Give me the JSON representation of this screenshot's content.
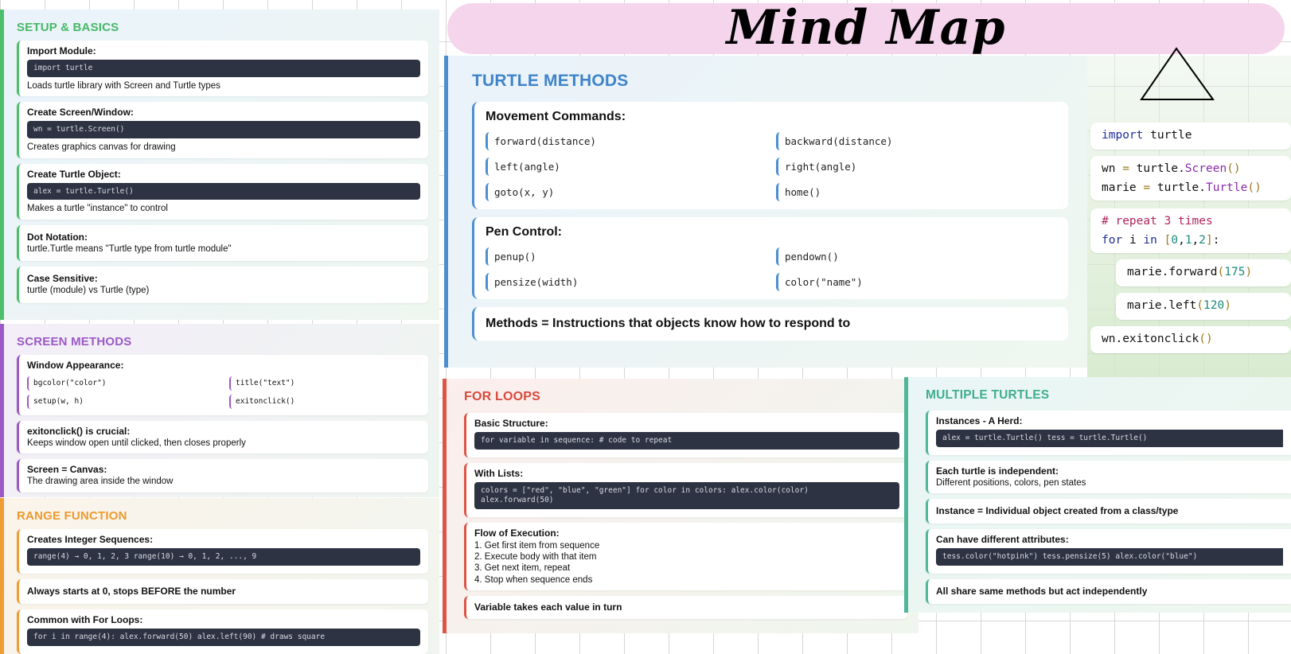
{
  "title": "Mind Map",
  "setup": {
    "title": "SETUP & BASICS",
    "cards": [
      {
        "heading": "Import Module:",
        "code": "import turtle",
        "text": "Loads turtle library with Screen and Turtle types"
      },
      {
        "heading": "Create Screen/Window:",
        "code": "wn = turtle.Screen()",
        "text": "Creates graphics canvas for drawing"
      },
      {
        "heading": "Create Turtle Object:",
        "code": "alex = turtle.Turtle()",
        "text": "Makes a turtle \"instance\" to control"
      },
      {
        "heading": "Dot Notation:",
        "text": "turtle.Turtle means \"Turtle type from turtle module\""
      },
      {
        "heading": "Case Sensitive:",
        "text": "turtle (module) vs Turtle (type)"
      }
    ]
  },
  "screen": {
    "title": "SCREEN METHODS",
    "appearance_heading": "Window Appearance:",
    "methods": [
      "bgcolor(\"color\")",
      "title(\"text\")",
      "setup(w, h)",
      "exitonclick()"
    ],
    "cards": [
      {
        "heading": "exitonclick() is crucial:",
        "text": "Keeps window open until clicked, then closes properly"
      },
      {
        "heading": "Screen = Canvas:",
        "text": "The drawing area inside the window"
      }
    ]
  },
  "range": {
    "title": "RANGE FUNCTION",
    "cards": [
      {
        "heading": "Creates Integer Sequences:",
        "code": "range(4) → 0, 1, 2, 3 range(10) → 0, 1, 2, ..., 9"
      },
      {
        "heading": "Always starts at 0, stops BEFORE the number"
      },
      {
        "heading": "Common with For Loops:",
        "code": "for i in range(4): alex.forward(50) alex.left(90) # draws square"
      }
    ]
  },
  "turtle_methods": {
    "title": "TURTLE METHODS",
    "movement_heading": "Movement Commands:",
    "movement": [
      "forward(distance)",
      "backward(distance)",
      "left(angle)",
      "right(angle)",
      "goto(x, y)",
      "home()"
    ],
    "pen_heading": "Pen Control:",
    "pen": [
      "penup()",
      "pendown()",
      "pensize(width)",
      "color(\"name\")"
    ],
    "summary": "Methods = Instructions that objects know how to respond to"
  },
  "code_snippet": {
    "line1_kw": "import",
    "line1_rest": " turtle",
    "line2": "wn",
    "line3": "marie",
    "turtle": "turtle",
    "screen_fn": "Screen",
    "turtle_fn": "Turtle",
    "comment": "# repeat 3 times",
    "for_kw": "for",
    "in_kw": "in",
    "loop_var": "i",
    "n0": "0",
    "n1": "1",
    "n2": "2",
    "forward_call": "marie.forward",
    "forward_arg": "175",
    "left_call": "marie.left",
    "left_arg": "120",
    "exit_call": "wn.exitonclick"
  },
  "for_loops": {
    "title": "FOR LOOPS",
    "cards": [
      {
        "heading": "Basic Structure:",
        "code": "for variable in sequence: # code to repeat"
      },
      {
        "heading": "With Lists:",
        "code": "colors = [\"red\", \"blue\", \"green\"] for color in colors: alex.color(color)\nalex.forward(50)"
      },
      {
        "heading": "Flow of Execution:",
        "steps": [
          "1. Get first item from sequence",
          "2. Execute body with that item",
          "3. Get next item, repeat",
          "4. Stop when sequence ends"
        ]
      },
      {
        "heading": "Variable takes each value in turn"
      }
    ]
  },
  "multiple": {
    "title": "MULTIPLE TURTLES",
    "cards": [
      {
        "heading": "Instances - A Herd:",
        "code": "alex = turtle.Turtle() tess = turtle.Turtle()"
      },
      {
        "heading": "Each turtle is independent:",
        "text": "Different positions, colors, pen states"
      },
      {
        "heading": "Instance = Individual object created from a class/type"
      },
      {
        "heading": "Can have different attributes:",
        "code": "tess.color(\"hotpink\") tess.pensize(5) alex.color(\"blue\")"
      },
      {
        "heading": "All share same methods but act independently"
      }
    ]
  },
  "colors": {
    "green": "#4dbf6b",
    "purple": "#9c59c6",
    "orange": "#ef9d35",
    "blue": "#4c8fd0",
    "red": "#dd5546",
    "teal": "#4fb69a",
    "pink_pill": "#f5d5ec"
  }
}
